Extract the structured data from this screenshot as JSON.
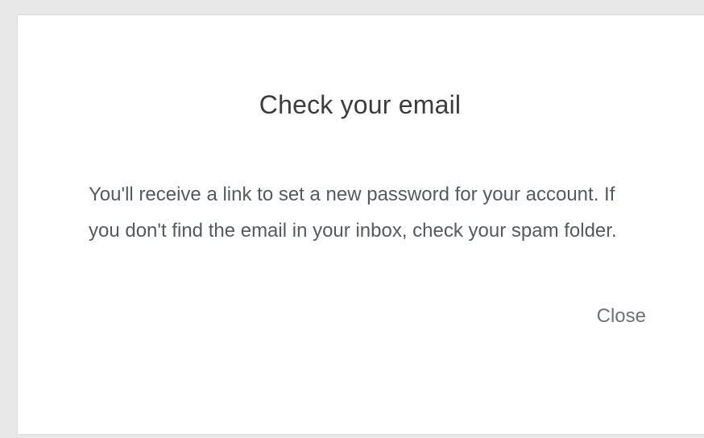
{
  "dialog": {
    "title": "Check your email",
    "message": "You'll receive a link to set a new password for your account. If you don't find the email in your inbox, check your spam folder.",
    "close_label": "Close"
  }
}
